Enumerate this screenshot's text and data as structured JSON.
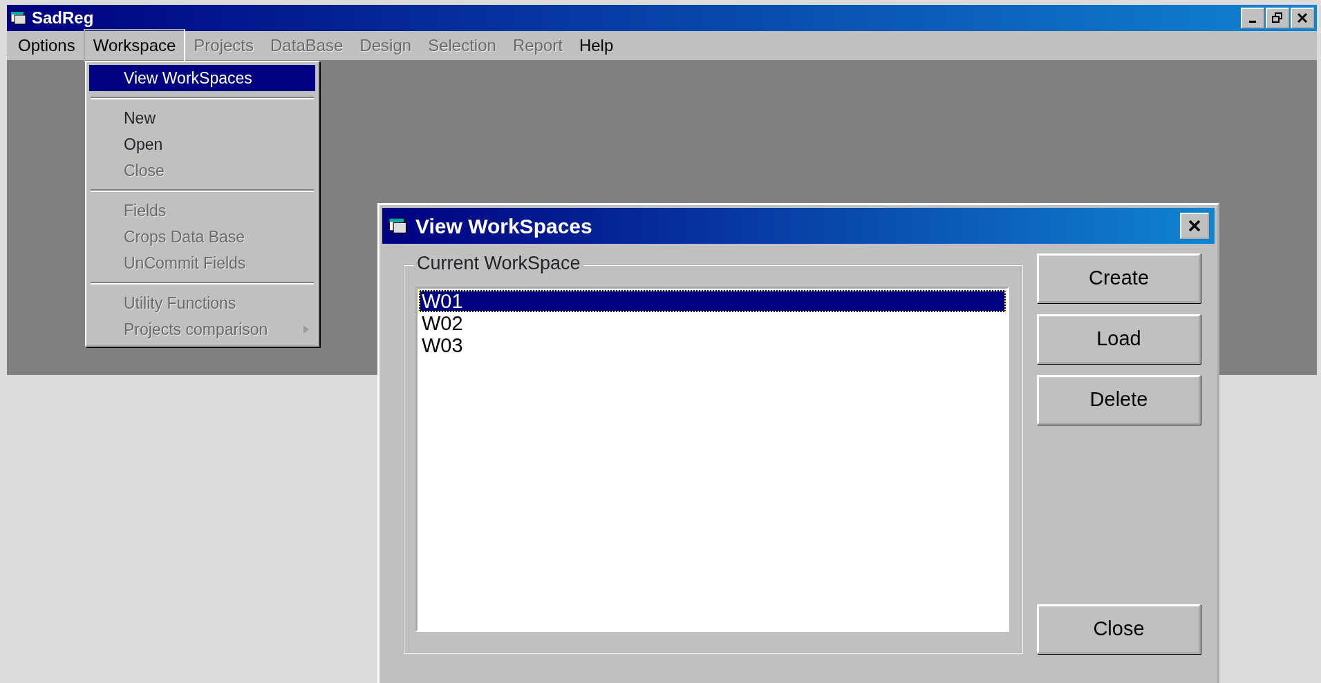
{
  "window": {
    "title": "SadReg"
  },
  "menu_bar": [
    {
      "label": "Options",
      "disabled": false,
      "open": false
    },
    {
      "label": "Workspace",
      "disabled": false,
      "open": true
    },
    {
      "label": "Projects",
      "disabled": true,
      "open": false
    },
    {
      "label": "DataBase",
      "disabled": true,
      "open": false
    },
    {
      "label": "Design",
      "disabled": true,
      "open": false
    },
    {
      "label": "Selection",
      "disabled": true,
      "open": false
    },
    {
      "label": "Report",
      "disabled": true,
      "open": false
    },
    {
      "label": "Help",
      "disabled": false,
      "open": false
    }
  ],
  "workspace_menu": [
    {
      "kind": "item",
      "label": "View WorkSpaces",
      "selected": true,
      "disabled": false
    },
    {
      "kind": "separator"
    },
    {
      "kind": "item",
      "label": "New",
      "selected": false,
      "disabled": false
    },
    {
      "kind": "item",
      "label": "Open",
      "selected": false,
      "disabled": false
    },
    {
      "kind": "item",
      "label": "Close",
      "selected": false,
      "disabled": true
    },
    {
      "kind": "separator"
    },
    {
      "kind": "item",
      "label": "Fields",
      "selected": false,
      "disabled": true
    },
    {
      "kind": "item",
      "label": "Crops Data Base",
      "selected": false,
      "disabled": true
    },
    {
      "kind": "item",
      "label": "UnCommit Fields",
      "selected": false,
      "disabled": true
    },
    {
      "kind": "separator"
    },
    {
      "kind": "item",
      "label": "Utility Functions",
      "selected": false,
      "disabled": true
    },
    {
      "kind": "submenu",
      "label": "Projects comparison",
      "selected": false,
      "disabled": true
    }
  ],
  "dialog": {
    "title": "View WorkSpaces",
    "group_label": "Current WorkSpace",
    "list": [
      {
        "label": "W01",
        "selected": true
      },
      {
        "label": "W02",
        "selected": false
      },
      {
        "label": "W03",
        "selected": false
      }
    ],
    "buttons": [
      "Create",
      "Load",
      "Delete"
    ],
    "close_button": "Close"
  }
}
